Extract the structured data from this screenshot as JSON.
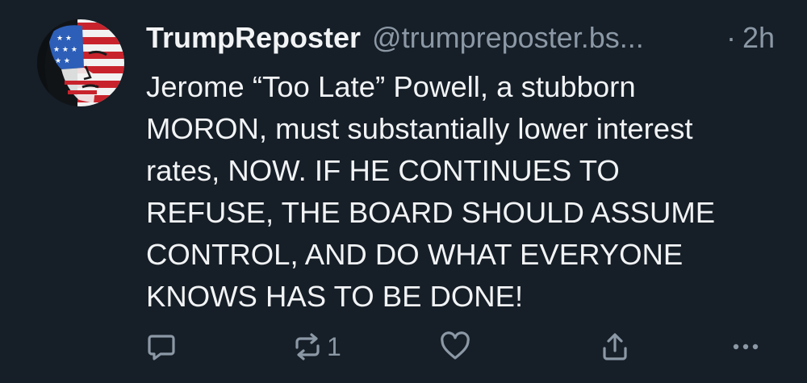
{
  "post": {
    "display_name": "TrumpReposter",
    "handle": "@trumpreposter.bs...",
    "separator": "·",
    "time": "2h",
    "text_lines": [
      "Jerome “Too Late” Powell, a stubborn",
      "MORON, must substantially lower interest",
      "rates, NOW. IF HE CONTINUES TO",
      "REFUSE, THE BOARD SHOULD ASSUME",
      "CONTROL, AND DO WHAT EVERYONE",
      "KNOWS HAS TO BE DONE!"
    ],
    "avatar_icon": "flag-face-avatar"
  },
  "actions": {
    "reply_icon": "reply-icon",
    "repost_icon": "repost-icon",
    "repost_count": "1",
    "like_icon": "heart-icon",
    "share_icon": "share-icon",
    "more_icon": "more-icon"
  },
  "colors": {
    "background": "#161e27",
    "text": "#f1f3f5",
    "muted": "#8b98a5"
  }
}
